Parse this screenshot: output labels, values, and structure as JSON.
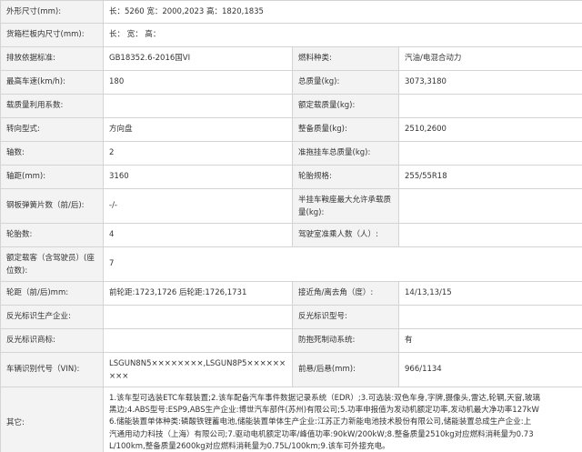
{
  "rows": {
    "outer_size": {
      "label": "外形尺寸(mm):",
      "value": "长：5260 宽：2000,2023 高：1820,1835"
    },
    "cargo_size": {
      "label": "货箱栏板内尺寸(mm):",
      "value": "长：   宽：   高："
    },
    "emission": {
      "label": "排放依据标准:",
      "value": "GB18352.6-2016国VI",
      "label2": "燃料种类:",
      "value2": "汽油/电混合动力"
    },
    "max_speed": {
      "label": "最高车速(km/h):",
      "value": "180",
      "label2": "总质量(kg):",
      "value2": "3073,3180"
    },
    "load_util": {
      "label": "载质量利用系数:",
      "value": "",
      "label2": "额定载质量(kg):",
      "value2": ""
    },
    "steering": {
      "label": "转向型式:",
      "value": "方向盘",
      "label2": "整备质量(kg):",
      "value2": "2510,2600"
    },
    "axles": {
      "label": "轴数:",
      "value": "2",
      "label2": "准拖挂车总质量(kg):",
      "value2": ""
    },
    "wheelbase": {
      "label": "轴距(mm):",
      "value": "3160",
      "label2": "轮胎规格:",
      "value2": "255/55R18"
    },
    "leaf_spring": {
      "label": "钢板弹簧片数（前/后):",
      "value": "-/-",
      "label2": "半挂车鞍座最大允许承载质量(kg):",
      "value2": ""
    },
    "tires": {
      "label": "轮胎数:",
      "value": "4",
      "label2": "驾驶室准乘人数（人）:",
      "value2": ""
    },
    "seats": {
      "label": "额定载客（含驾驶员）(座位数):",
      "value": "7"
    },
    "track": {
      "label": "轮距（前/后)mm:",
      "value": "前轮距:1723,1726 后轮距:1726,1731",
      "label2": "接近角/离去角（度）:",
      "value2": "14/13,13/15"
    },
    "reflect_company": {
      "label": "反光标识生产企业:",
      "value": "",
      "label2": "反光标识型号:",
      "value2": ""
    },
    "reflect_brand": {
      "label": "反光标识商标:",
      "value": "",
      "label2": "防抱死制动系统:",
      "value2": "有"
    },
    "vin": {
      "label": "车辆识别代号（VIN):",
      "value": "LSGUN8N5××××××××,LSGUN8P5×××××××××",
      "label2": "前悬/后悬(mm):",
      "value2": "966/1134"
    },
    "other": {
      "label": "其它:",
      "lines": [
        "1.该车型可选装ETC车载装置;2.该车配备汽车事件数据记录系统（EDR）;3.可选装:双色车身,字牌,摄像头,雷达,轮辋,天窗,玻璃",
        "黑边;4.ABS型号:ESP9,ABS生产企业:博世汽车部件(苏州)有限公司;5.功率申报值为发动机额定功率,发动机最大净功率127kW",
        "6.储能装置单体种类:磷酸铁锂蓄电池,储能装置单体生产企业:江苏正力新能电池技术股份有限公司,储能装置总成生产企业:上",
        "汽通用动力科技（上海）有限公司;7.驱动电机额定功率/峰值功率:90kW/200kW;8.整备质量2510kg对应燃料消耗量为0.73",
        "L/100km,整备质量2600kg对应燃料消耗量为0.75L/100km;9.该车可外接充电。"
      ]
    }
  }
}
